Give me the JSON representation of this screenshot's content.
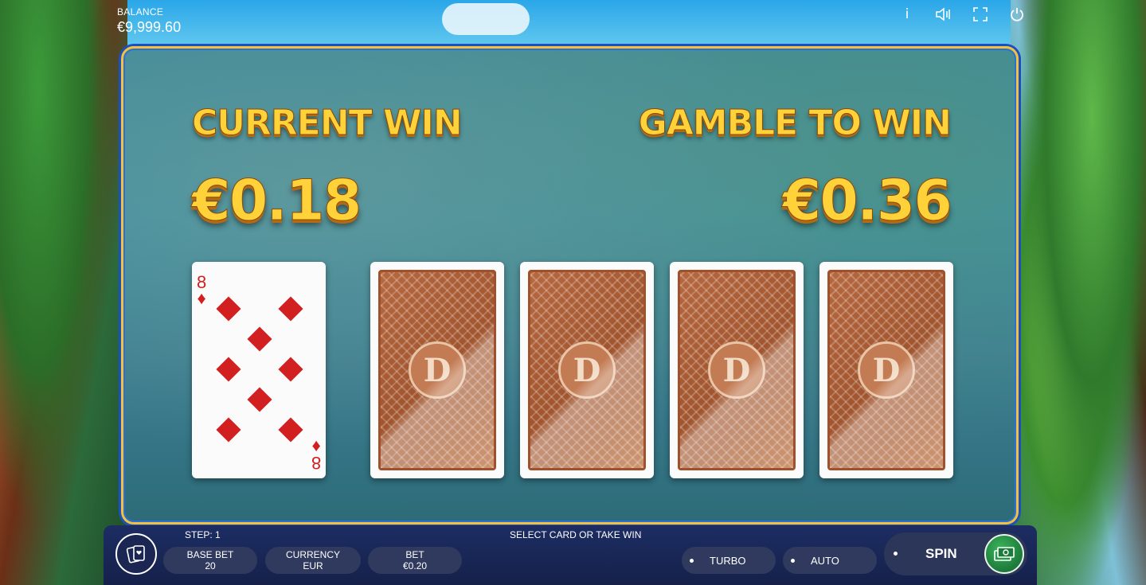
{
  "hud": {
    "balance_label": "BALANCE",
    "balance_value": "€9,999.60",
    "icons": [
      "info-icon",
      "sound-icon",
      "fullscreen-icon",
      "power-icon"
    ]
  },
  "gamble": {
    "current_win_label": "CURRENT WIN",
    "current_win_value": "€0.18",
    "gamble_to_win_label": "GAMBLE TO WIN",
    "gamble_to_win_value": "€0.36",
    "dealer_card": {
      "rank": "8",
      "suit": "diamonds",
      "color": "#d21f1f"
    },
    "face_down_cards": 4
  },
  "bottom_bar": {
    "step": "STEP: 1",
    "message": "SELECT CARD OR TAKE WIN",
    "base_bet_label": "BASE BET",
    "base_bet_value": "20",
    "currency_label": "CURRENCY",
    "currency_value": "EUR",
    "bet_label": "BET",
    "bet_value": "€0.20",
    "turbo_label": "TURBO",
    "auto_label": "AUTO",
    "spin_label": "SPIN"
  },
  "colors": {
    "gold_text": "#ffd23a",
    "panel_border": "#f3c13a",
    "card_back": "#a0542d",
    "bar": "#1d2d63"
  }
}
